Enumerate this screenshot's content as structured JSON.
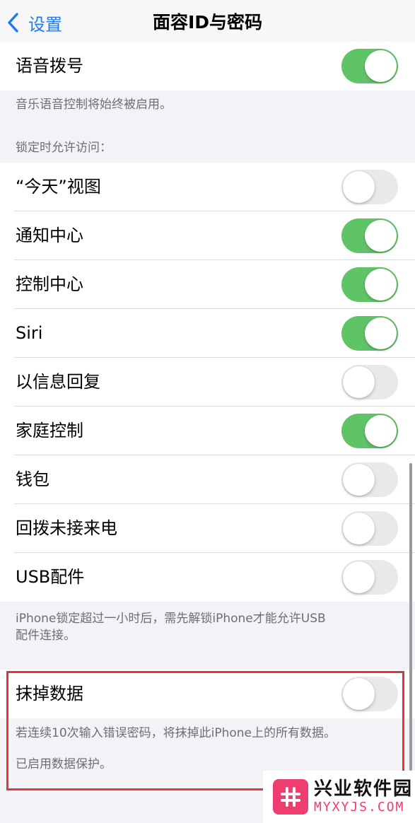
{
  "navbar": {
    "back_label": "设置",
    "title": "面容ID与密码"
  },
  "voice_dial": {
    "label": "语音拨号",
    "on": true,
    "footer": "音乐语音控制将始终被启用。"
  },
  "lock_access": {
    "header": "锁定时允许访问：",
    "items": [
      {
        "label": "“今天”视图",
        "on": false
      },
      {
        "label": "通知中心",
        "on": true
      },
      {
        "label": "控制中心",
        "on": true
      },
      {
        "label": "Siri",
        "on": true
      },
      {
        "label": "以信息回复",
        "on": false
      },
      {
        "label": "家庭控制",
        "on": true
      },
      {
        "label": "钱包",
        "on": false
      },
      {
        "label": "回拨未接来电",
        "on": false
      },
      {
        "label": "USB配件",
        "on": false
      }
    ],
    "footer_line1": "iPhone锁定超过一小时后，需先解锁iPhone才能允许USB",
    "footer_line2": "配件连接。"
  },
  "erase": {
    "label": "抹掉数据",
    "on": false,
    "footer_line1": "若连续10次输入错误密码，将抹掉此iPhone上的所有数据。",
    "footer_line2": "已启用数据保护。"
  },
  "watermark": {
    "name": "兴业软件园",
    "domain": "MYXYJS.COM"
  },
  "colors": {
    "accent": "#1a7cf5",
    "toggle_on": "#5fc466",
    "highlight": "#e0363c",
    "watermark": "#ef3d6f"
  }
}
